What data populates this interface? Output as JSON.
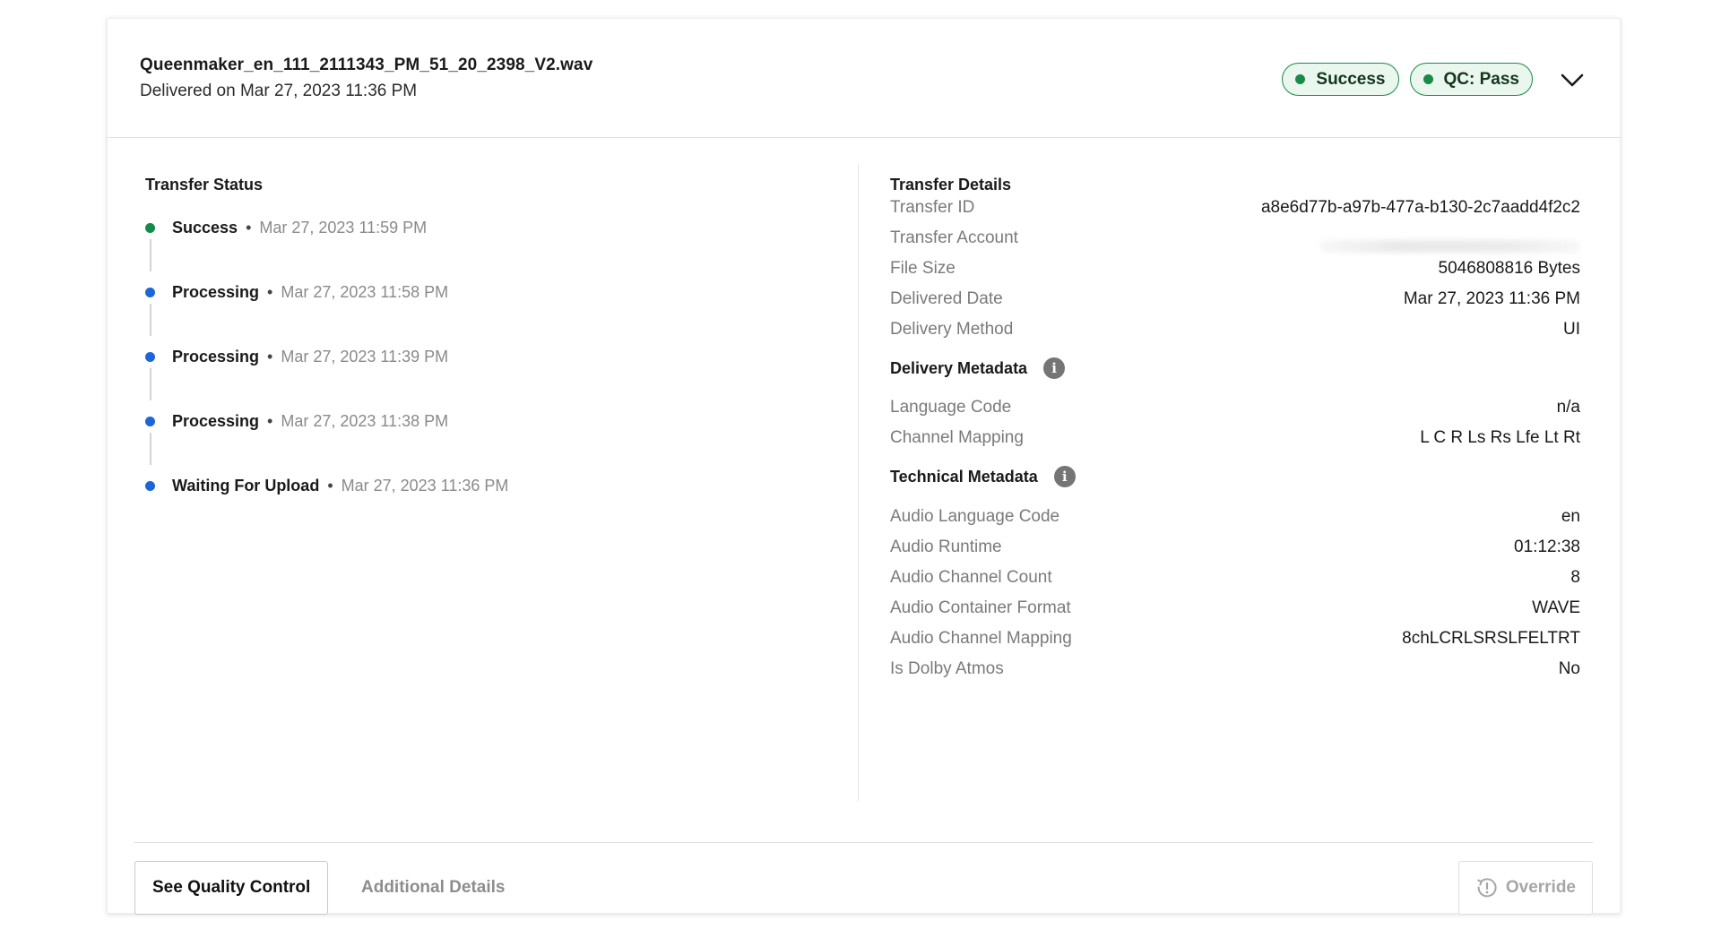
{
  "header": {
    "file_name": "Queenmaker_en_111_2111343_PM_51_20_2398_V2.wav",
    "delivered_on": "Delivered on Mar 27, 2023 11:36 PM",
    "badges": [
      {
        "label": "Success",
        "color": "#1a8a4a"
      },
      {
        "label": "QC: Pass",
        "color": "#1a8a4a"
      }
    ],
    "toggle_icon": "chevron-down-icon"
  },
  "transfer_status": {
    "title": "Transfer Status",
    "separator": "•",
    "items": [
      {
        "status": "Success",
        "time": "Mar 27, 2023 11:59 PM",
        "color": "#13894a"
      },
      {
        "status": "Processing",
        "time": "Mar 27, 2023 11:58 PM",
        "color": "#1b66d8"
      },
      {
        "status": "Processing",
        "time": "Mar 27, 2023 11:39 PM",
        "color": "#1b66d8"
      },
      {
        "status": "Processing",
        "time": "Mar 27, 2023 11:38 PM",
        "color": "#1b66d8"
      },
      {
        "status": "Waiting For Upload",
        "time": "Mar 27, 2023 11:36 PM",
        "color": "#1b66d8"
      }
    ]
  },
  "transfer_details": {
    "title": "Transfer Details",
    "rows": [
      {
        "key": "Transfer ID",
        "value": "a8e6d77b-a97b-477a-b130-2c7aadd4f2c2"
      },
      {
        "key": "Transfer Account",
        "value": ""
      },
      {
        "key": "File Size",
        "value": "5046808816 Bytes"
      },
      {
        "key": "Delivered Date",
        "value": "Mar 27, 2023 11:36 PM"
      },
      {
        "key": "Delivery Method",
        "value": "UI"
      }
    ]
  },
  "delivery_metadata": {
    "title": "Delivery Metadata",
    "info_icon": "info-icon",
    "rows": [
      {
        "key": "Language Code",
        "value": "n/a"
      },
      {
        "key": "Channel Mapping",
        "value": "L C R Ls Rs Lfe Lt Rt"
      }
    ]
  },
  "technical_metadata": {
    "title": "Technical Metadata",
    "info_icon": "info-icon",
    "rows": [
      {
        "key": "Audio Language Code",
        "value": "en"
      },
      {
        "key": "Audio Runtime",
        "value": "01:12:38"
      },
      {
        "key": "Audio Channel Count",
        "value": "8"
      },
      {
        "key": "Audio Container Format",
        "value": "WAVE"
      },
      {
        "key": "Audio Channel Mapping",
        "value": "8chLCRLSRSLFELTRT"
      },
      {
        "key": "Is Dolby Atmos",
        "value": "No"
      }
    ]
  },
  "footer": {
    "see_qc_label": "See Quality Control",
    "additional_details_label": "Additional Details",
    "override_label": "Override",
    "override_icon": "override-clock-icon"
  }
}
